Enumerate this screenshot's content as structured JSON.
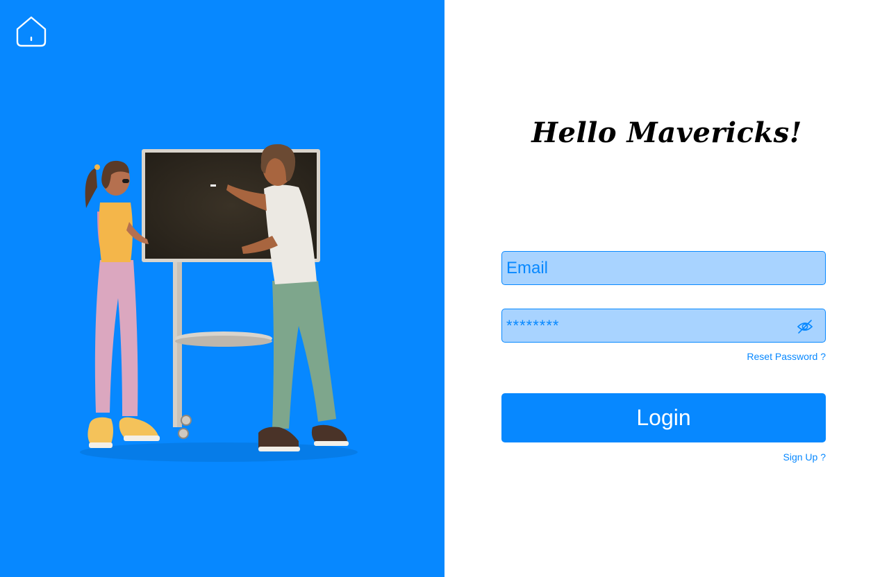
{
  "page": {
    "accent_color": "#0788FF",
    "field_background": "#A8D3FF"
  },
  "left_panel": {
    "home_icon": "home-icon",
    "illustration": "two people writing on a chalkboard"
  },
  "form": {
    "greeting": "Hello Mavericks!",
    "email": {
      "placeholder": "Email",
      "value": ""
    },
    "password": {
      "masked_value": "********",
      "toggle_icon": "eye-off-icon"
    },
    "reset_link": "Reset Password ?",
    "login_label": "Login",
    "signup_link": "Sign Up ?"
  }
}
